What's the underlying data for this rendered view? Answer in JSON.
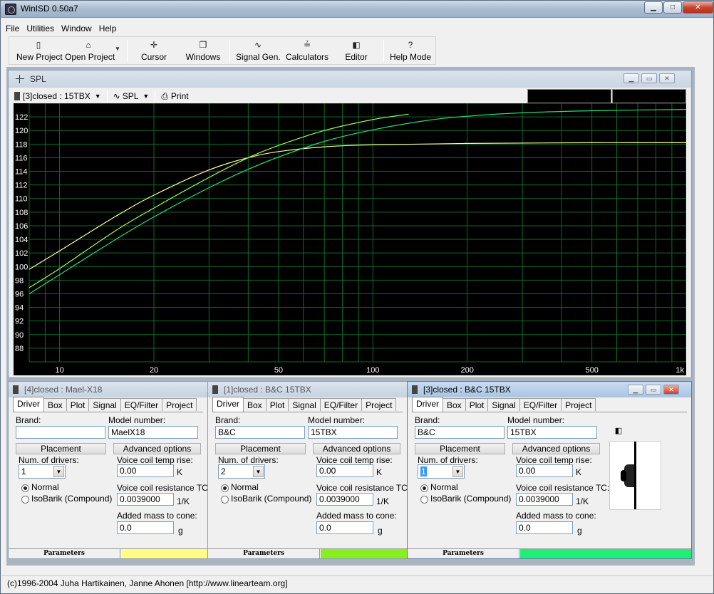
{
  "app": {
    "title": "WinISD 0.50a7"
  },
  "menu": [
    "File",
    "Utilities",
    "Window",
    "Help"
  ],
  "toolbar": {
    "new_project": "New Project",
    "open_project": "Open Project",
    "cursor": "Cursor",
    "windows": "Windows",
    "signal_gen": "Signal Gen.",
    "calculators": "Calculators",
    "editor": "Editor",
    "help_mode": "Help Mode"
  },
  "spl_window": {
    "title": "SPL",
    "project_selector": "[3]closed : 15TBX",
    "graph_selector": "SPL",
    "print": "Print"
  },
  "chart_data": {
    "type": "line",
    "xscale": "log",
    "xlim": [
      8,
      1000
    ],
    "ylim": [
      86,
      124
    ],
    "x_tick_labels": [
      "10",
      "20",
      "50",
      "100",
      "200",
      "500",
      "1k"
    ],
    "y_tick_labels": [
      "122",
      "120",
      "118",
      "116",
      "114",
      "112",
      "110",
      "108",
      "106",
      "104",
      "102",
      "100",
      "98",
      "96",
      "94",
      "92",
      "90",
      "88"
    ],
    "grid": true,
    "series": [
      {
        "color": "#ffff99",
        "x": [
          8,
          10,
          15,
          20,
          30,
          40,
          50,
          70,
          100,
          200,
          500,
          1000
        ],
        "y": [
          99.6,
          102.3,
          107.3,
          110.5,
          114.2,
          116.0,
          116.9,
          117.6,
          117.9,
          118.1,
          118.2,
          118.2
        ]
      },
      {
        "color": "#a0ff50",
        "x": [
          8,
          10,
          15,
          20,
          30,
          40,
          50,
          70,
          100,
          130
        ],
        "y": [
          96.9,
          99.7,
          105.2,
          108.6,
          113.1,
          116.0,
          117.8,
          120.0,
          121.6,
          122.4
        ]
      },
      {
        "color": "#22dd77",
        "x": [
          8,
          10,
          15,
          20,
          30,
          40,
          50,
          70,
          100,
          150,
          200,
          300,
          500,
          1000
        ],
        "y": [
          96.0,
          98.8,
          103.9,
          107.3,
          111.6,
          114.3,
          116.1,
          118.4,
          120.1,
          121.5,
          122.1,
          122.6,
          122.9,
          123.1
        ]
      }
    ]
  },
  "panels": [
    {
      "title": "[4]closed :  Mael-X18",
      "tabs": [
        "Driver",
        "Box",
        "Plot",
        "Signal",
        "EQ/Filter",
        "Project"
      ],
      "brand_label": "Brand:",
      "brand": "",
      "model_label": "Model number:",
      "model": "MaelX18",
      "placement": "Placement",
      "advanced": "Advanced options",
      "num_drivers_label": "Num. of drivers:",
      "num_drivers": "1",
      "vc_temp_label": "Voice coil temp rise:",
      "vc_temp": "0.00",
      "vc_temp_unit": "K",
      "normal": "Normal",
      "isobarik": "IsoBarik (Compound)",
      "vc_res_label": "Voice coil resistance TC:",
      "vc_res": "0.0039000",
      "vc_res_unit": "1/K",
      "mass_label": "Added mass to cone:",
      "mass": "0.0",
      "mass_unit": "g",
      "params_label": "Parameters",
      "color": "#ffff88"
    },
    {
      "title": "[1]closed : B&C 15TBX",
      "tabs": [
        "Driver",
        "Box",
        "Plot",
        "Signal",
        "EQ/Filter",
        "Project"
      ],
      "brand_label": "Brand:",
      "brand": "B&C",
      "model_label": "Model number:",
      "model": "15TBX",
      "placement": "Placement",
      "advanced": "Advanced options",
      "num_drivers_label": "Num. of drivers:",
      "num_drivers": "2",
      "vc_temp_label": "Voice coil temp rise:",
      "vc_temp": "0.00",
      "vc_temp_unit": "K",
      "normal": "Normal",
      "isobarik": "IsoBarik (Compound)",
      "vc_res_label": "Voice coil resistance TC:",
      "vc_res": "0.0039000",
      "vc_res_unit": "1/K",
      "mass_label": "Added mass to cone:",
      "mass": "0.0",
      "mass_unit": "g",
      "params_label": "Parameters",
      "color": "#88ee22"
    },
    {
      "title": "[3]closed : B&C 15TBX",
      "tabs": [
        "Driver",
        "Box",
        "Plot",
        "Signal",
        "EQ/Filter",
        "Project"
      ],
      "brand_label": "Brand:",
      "brand": "B&C",
      "model_label": "Model number:",
      "model": "15TBX",
      "placement": "Placement",
      "advanced": "Advanced options",
      "num_drivers_label": "Num. of drivers:",
      "num_drivers": "1",
      "vc_temp_label": "Voice coil temp rise:",
      "vc_temp": "0.00",
      "vc_temp_unit": "K",
      "normal": "Normal",
      "isobarik": "IsoBarik (Compound)",
      "vc_res_label": "Voice coil resistance TC:",
      "vc_res": "0.0039000",
      "vc_res_unit": "1/K",
      "mass_label": "Added mass to cone:",
      "mass": "0.0",
      "mass_unit": "g",
      "params_label": "Parameters",
      "color": "#22ee77"
    }
  ],
  "status": "(c)1996-2004 Juha Hartikainen, Janne Ahonen [http://www.linearteam.org]"
}
